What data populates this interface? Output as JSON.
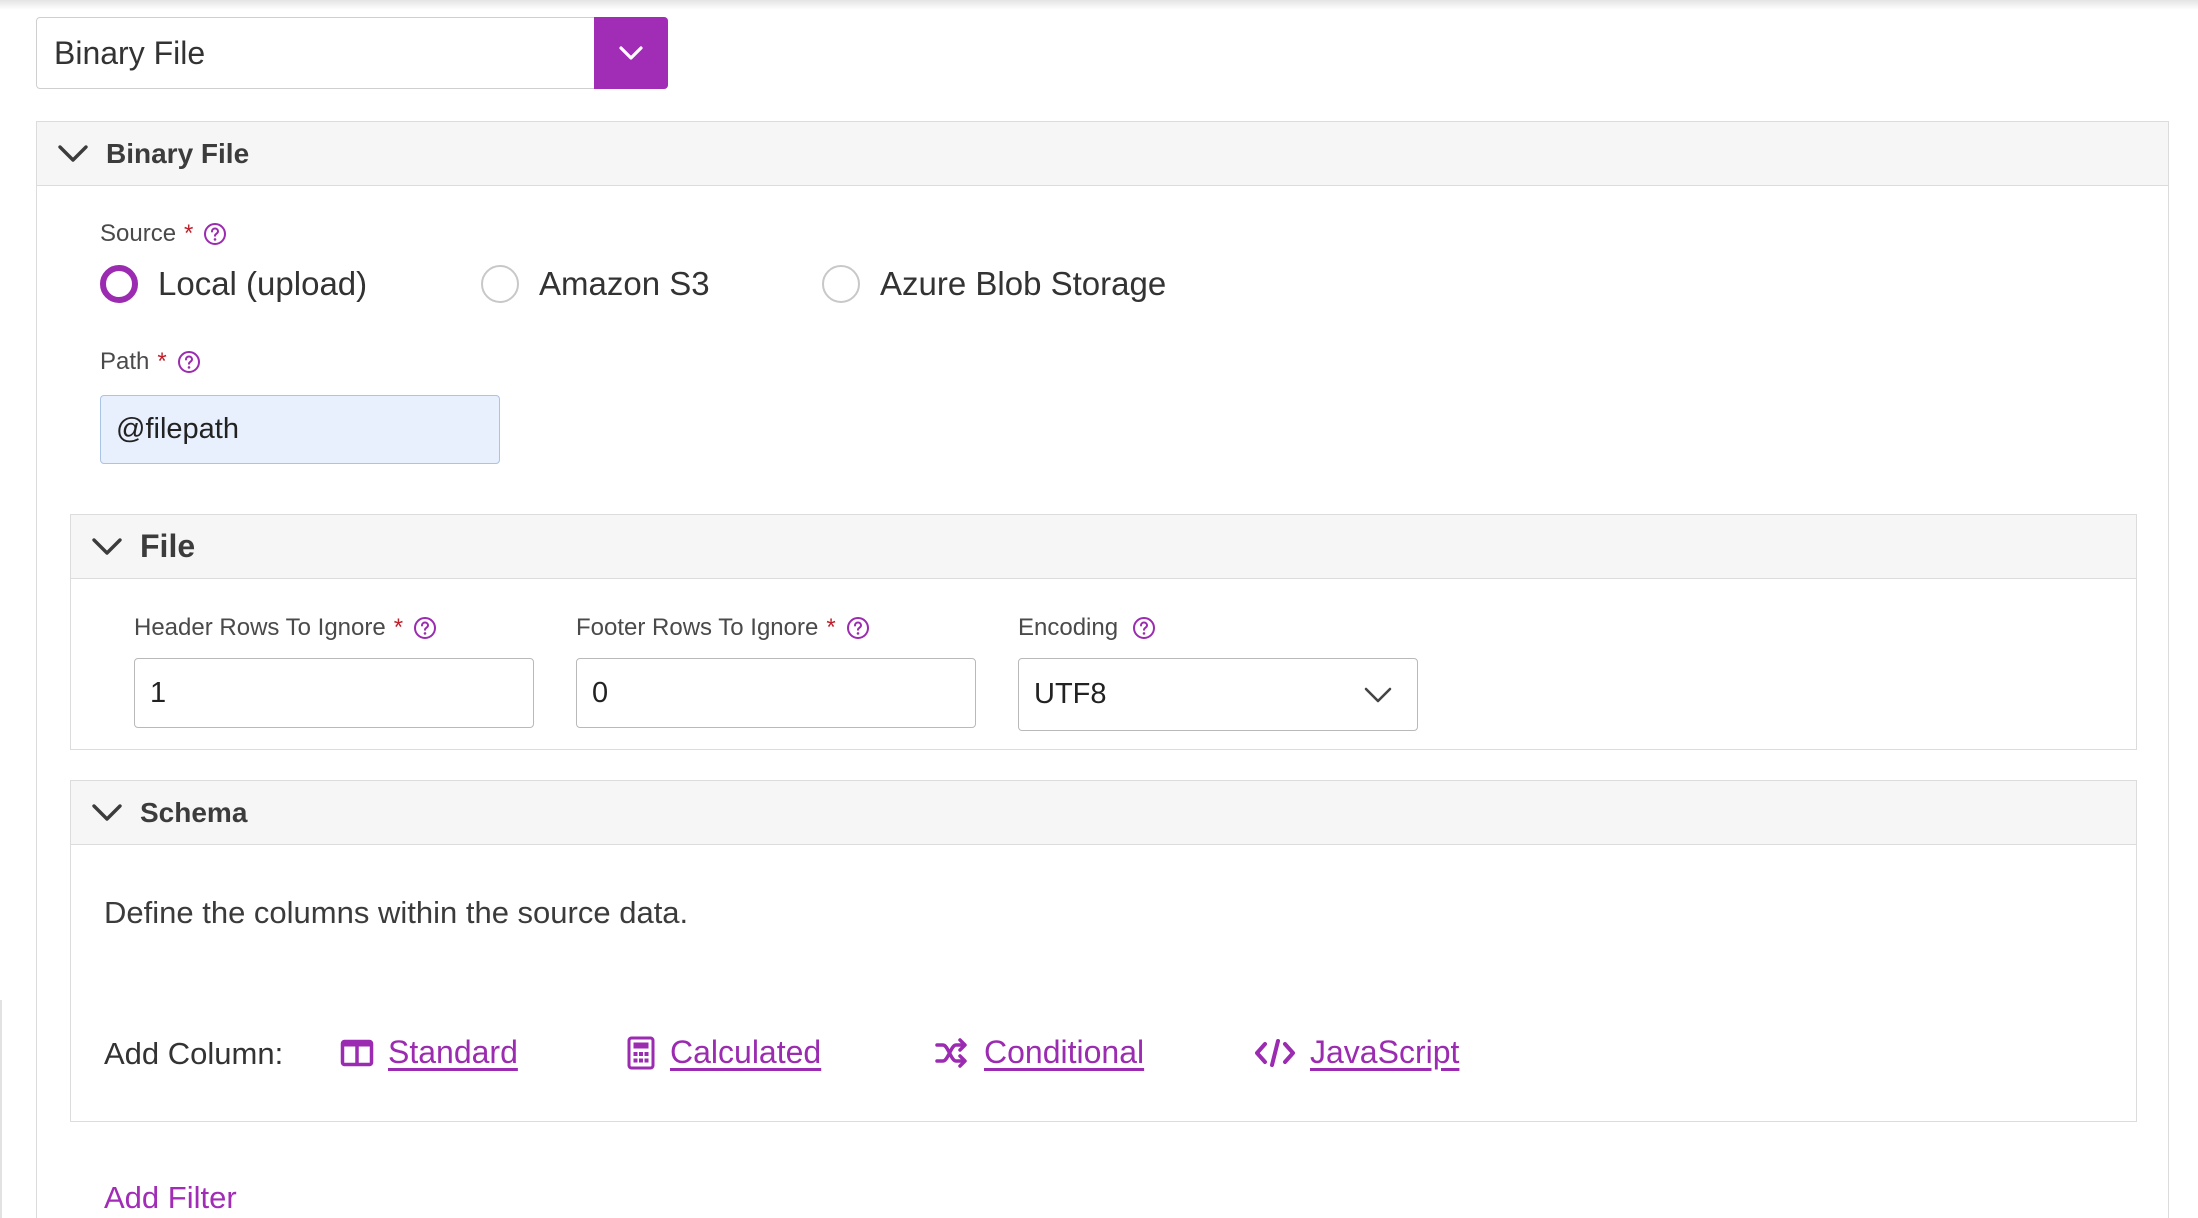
{
  "type_select": {
    "value": "Binary File"
  },
  "binary_panel": {
    "title": "Binary File",
    "source": {
      "label": "Source",
      "required": "*",
      "options": [
        "Local (upload)",
        "Amazon S3",
        "Azure Blob Storage"
      ],
      "selected": "Local (upload)"
    },
    "path": {
      "label": "Path",
      "required": "*",
      "value": "@filepath"
    }
  },
  "file_panel": {
    "title": "File",
    "header_rows": {
      "label": "Header Rows To Ignore",
      "required": "*",
      "value": "1"
    },
    "footer_rows": {
      "label": "Footer Rows To Ignore",
      "required": "*",
      "value": "0"
    },
    "encoding": {
      "label": "Encoding",
      "value": "UTF8"
    }
  },
  "schema_panel": {
    "title": "Schema",
    "description": "Define the columns within the source data.",
    "add_column_label": "Add Column:",
    "links": {
      "standard": "Standard",
      "calculated": "Calculated",
      "conditional": "Conditional",
      "javascript": "JavaScript"
    }
  },
  "add_filter": "Add Filter",
  "colors": {
    "accent": "#9b2bb0",
    "required": "#c0202c",
    "path_bg": "#e7f0fc"
  }
}
